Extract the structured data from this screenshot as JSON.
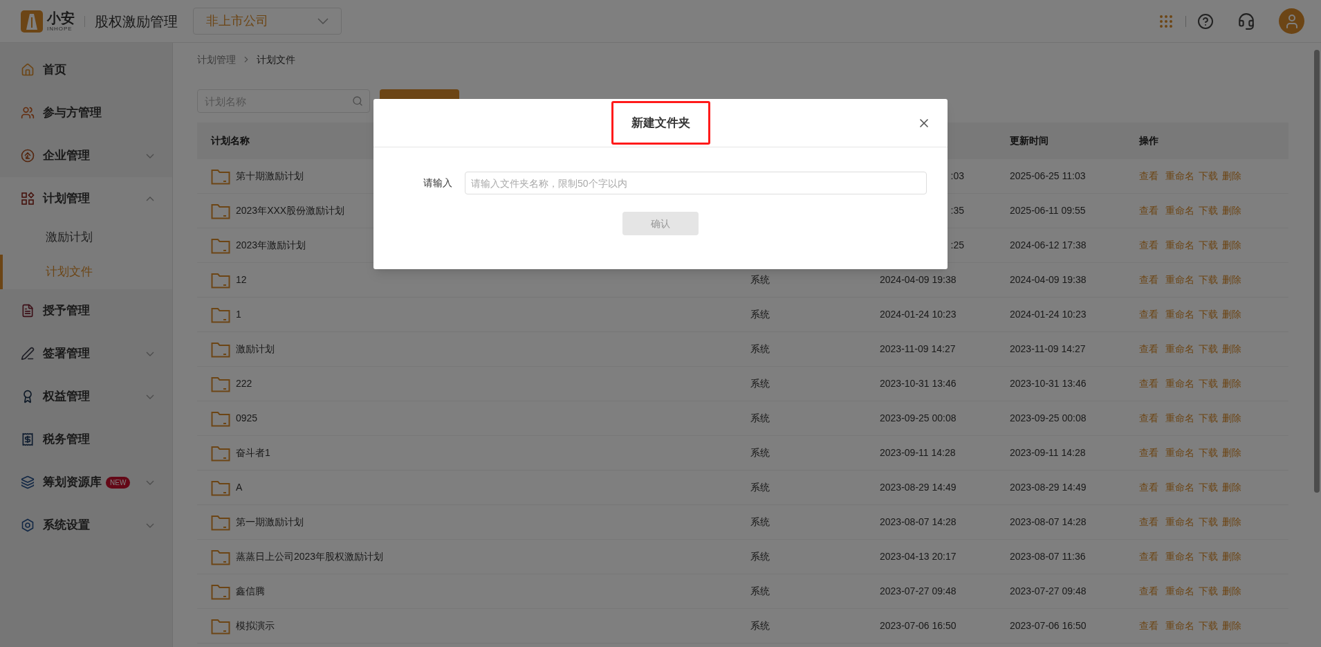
{
  "header": {
    "logo_text": "小安",
    "logo_subtext": "INHOPE",
    "app_title": "股权激励管理",
    "company_select": {
      "value": "非上市公司"
    }
  },
  "sidebar": {
    "items": [
      {
        "label": "首页",
        "kind": "link"
      },
      {
        "label": "参与方管理",
        "kind": "link"
      },
      {
        "label": "企业管理",
        "kind": "menu",
        "expanded": false
      },
      {
        "label": "计划管理",
        "kind": "menu",
        "expanded": true,
        "children": [
          {
            "label": "激励计划",
            "selected": false
          },
          {
            "label": "计划文件",
            "selected": true
          }
        ]
      },
      {
        "label": "授予管理",
        "kind": "link"
      },
      {
        "label": "签署管理",
        "kind": "menu",
        "expanded": false
      },
      {
        "label": "权益管理",
        "kind": "menu",
        "expanded": false
      },
      {
        "label": "税务管理",
        "kind": "link"
      },
      {
        "label": "筹划资源库",
        "kind": "menu",
        "expanded": false,
        "badge": "NEW"
      },
      {
        "label": "系统设置",
        "kind": "menu",
        "expanded": false
      }
    ]
  },
  "breadcrumb": [
    "计划管理",
    "计划文件"
  ],
  "search": {
    "placeholder": "计划名称"
  },
  "table": {
    "columns": {
      "name": "计划名称",
      "column_4": "更新时间",
      "column_5": "操作"
    },
    "rows": [
      {
        "name": "第十期激励计划",
        "column_3": ":03",
        "column_4": "2025-06-25 11:03",
        "actions": [
          "查看",
          "重命名",
          "下载",
          "删除"
        ]
      },
      {
        "name": "2023年XXX股份激励计划",
        "column_3": ":35",
        "column_4": "2025-06-11 09:55",
        "actions": [
          "查看",
          "重命名",
          "下载",
          "删除"
        ]
      },
      {
        "name": "2023年激励计划",
        "column_3": ":25",
        "column_4": "2024-06-12 17:38",
        "actions": [
          "查看",
          "重命名",
          "下载",
          "删除"
        ]
      },
      {
        "name": "12",
        "column_2": "系统",
        "column_3": "2024-04-09 19:38",
        "column_4": "2024-04-09 19:38",
        "actions": [
          "查看",
          "重命名",
          "下载",
          "删除"
        ]
      },
      {
        "name": "1",
        "column_2": "系统",
        "column_3": "2024-01-24 10:23",
        "column_4": "2024-01-24 10:23",
        "actions": [
          "查看",
          "重命名",
          "下载",
          "删除"
        ]
      },
      {
        "name": "激励计划",
        "column_2": "系统",
        "column_3": "2023-11-09 14:27",
        "column_4": "2023-11-09 14:27",
        "actions": [
          "查看",
          "重命名",
          "下载",
          "删除"
        ]
      },
      {
        "name": "222",
        "column_2": "系统",
        "column_3": "2023-10-31 13:46",
        "column_4": "2023-10-31 13:46",
        "actions": [
          "查看",
          "重命名",
          "下载",
          "删除"
        ]
      },
      {
        "name": "0925",
        "column_2": "系统",
        "column_3": "2023-09-25 00:08",
        "column_4": "2023-09-25 00:08",
        "actions": [
          "查看",
          "重命名",
          "下载",
          "删除"
        ]
      },
      {
        "name": "奋斗者1",
        "column_2": "系统",
        "column_3": "2023-09-11 14:28",
        "column_4": "2023-09-11 14:28",
        "actions": [
          "查看",
          "重命名",
          "下载",
          "删除"
        ]
      },
      {
        "name": "A",
        "column_2": "系统",
        "column_3": "2023-08-29 14:49",
        "column_4": "2023-08-29 14:49",
        "actions": [
          "查看",
          "重命名",
          "下载",
          "删除"
        ]
      },
      {
        "name": "第一期激励计划",
        "column_2": "系统",
        "column_3": "2023-08-07 14:28",
        "column_4": "2023-08-07 14:28",
        "actions": [
          "查看",
          "重命名",
          "下载",
          "删除"
        ]
      },
      {
        "name": "蒸蒸日上公司2023年股权激励计划",
        "column_2": "系统",
        "column_3": "2023-04-13 20:17",
        "column_4": "2023-08-07 11:36",
        "actions": [
          "查看",
          "重命名",
          "下载",
          "删除"
        ]
      },
      {
        "name": "鑫信腾",
        "column_2": "系统",
        "column_3": "2023-07-27 09:48",
        "column_4": "2023-07-27 09:48",
        "actions": [
          "查看",
          "重命名",
          "下载",
          "删除"
        ]
      },
      {
        "name": "模拟演示",
        "column_2": "系统",
        "column_3": "2023-07-06 16:50",
        "column_4": "2023-07-06 16:50",
        "actions": [
          "查看",
          "重命名",
          "下载",
          "删除"
        ]
      }
    ]
  },
  "dialog": {
    "title": "新建文件夹",
    "title_highlighted": true,
    "field_label": "请输入",
    "field_placeholder": "请输入文件夹名称，限制50个字以内",
    "confirm_button": {
      "label": "确认",
      "disabled": true
    }
  }
}
